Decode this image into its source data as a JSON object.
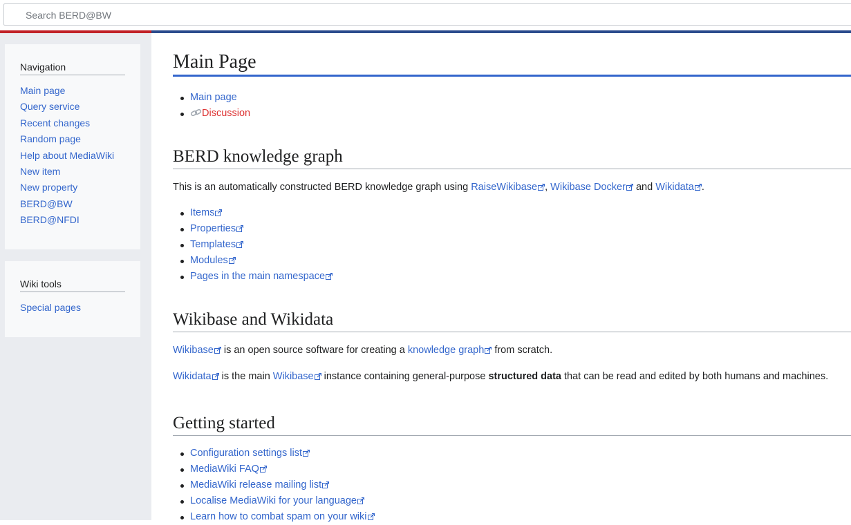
{
  "search": {
    "placeholder": "Search BERD@BW"
  },
  "sidebar": {
    "navigation": {
      "heading": "Navigation",
      "items": [
        {
          "label": "Main page"
        },
        {
          "label": "Query service"
        },
        {
          "label": "Recent changes"
        },
        {
          "label": "Random page"
        },
        {
          "label": "Help about MediaWiki"
        },
        {
          "label": "New item"
        },
        {
          "label": "New property"
        },
        {
          "label": "BERD@BW"
        },
        {
          "label": "BERD@NFDI"
        }
      ]
    },
    "tools": {
      "heading": "Wiki tools",
      "items": [
        {
          "label": "Special pages"
        }
      ]
    }
  },
  "page": {
    "title": "Main Page",
    "tabs": [
      {
        "label": "Main page"
      },
      {
        "label": "Discussion"
      }
    ],
    "sections": {
      "berd": {
        "heading": "BERD knowledge graph",
        "intro_prefix": "This is an automatically constructed BERD knowledge graph using ",
        "link1": "RaiseWikibase",
        "sep1": ", ",
        "link2": "Wikibase Docker",
        "sep2": " and ",
        "link3": "Wikidata",
        "end": ".",
        "links": [
          {
            "label": "Items"
          },
          {
            "label": "Properties"
          },
          {
            "label": "Templates"
          },
          {
            "label": "Modules"
          },
          {
            "label": "Pages in the main namespace"
          }
        ]
      },
      "wikibase": {
        "heading": "Wikibase and Wikidata",
        "p1_link1": "Wikibase",
        "p1_mid": " is an open source software for creating a ",
        "p1_link2": "knowledge graph",
        "p1_end": " from scratch.",
        "p2_link1": "Wikidata",
        "p2_mid": " is the main ",
        "p2_link2": "Wikibase",
        "p2_mid2": " instance containing general-purpose ",
        "p2_bold": "structured data",
        "p2_end": " that can be read and edited by both humans and machines."
      },
      "getting_started": {
        "heading": "Getting started",
        "links": [
          {
            "label": "Configuration settings list"
          },
          {
            "label": "MediaWiki FAQ"
          },
          {
            "label": "MediaWiki release mailing list"
          },
          {
            "label": "Localise MediaWiki for your language"
          },
          {
            "label": "Learn how to combat spam on your wiki"
          }
        ]
      }
    }
  },
  "icons": {
    "external": "external-link-icon",
    "chain": "link-chain-icon"
  },
  "colors": {
    "link": "#3366cc",
    "redlink": "#dd3333",
    "band_red": "#c12127",
    "band_blue": "#2a4b8d"
  }
}
